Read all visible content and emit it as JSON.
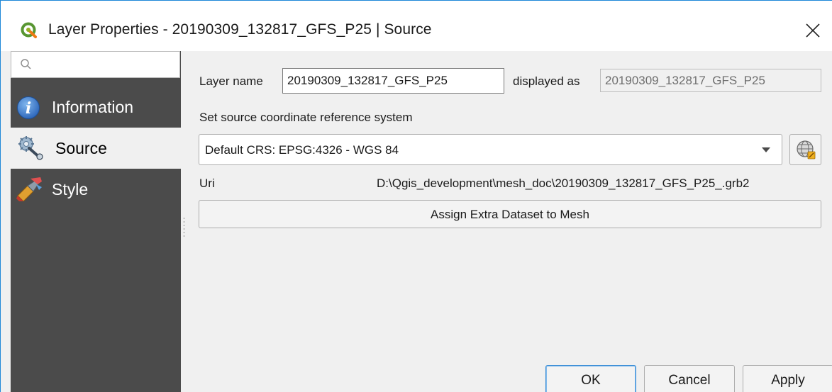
{
  "window": {
    "title": "Layer Properties - 20190309_132817_GFS_P25 | Source",
    "accent_color": "#1e88d8"
  },
  "sidebar": {
    "search": {
      "placeholder": "",
      "value": ""
    },
    "items": [
      {
        "label": "Information",
        "icon": "information-icon",
        "selected": false
      },
      {
        "label": "Source",
        "icon": "source-icon",
        "selected": true
      },
      {
        "label": "Style",
        "icon": "style-icon",
        "selected": false
      }
    ],
    "background_color": "#4b4b4b"
  },
  "source": {
    "layer_name_label": "Layer name",
    "layer_name_value": "20190309_132817_GFS_P25",
    "displayed_as_label": "displayed as",
    "displayed_as_value": "20190309_132817_GFS_P25",
    "crs_heading": "Set source coordinate reference system",
    "crs_selected": "Default CRS: EPSG:4326 - WGS 84",
    "crs_button_icon": "crs-globe-icon",
    "uri_label": "Uri",
    "uri_value": "D:\\Qgis_development\\mesh_doc\\20190309_132817_GFS_P25_.grb2",
    "assign_button": "Assign Extra Dataset to Mesh"
  },
  "buttons": {
    "ok": "OK",
    "cancel": "Cancel",
    "apply": "Apply"
  }
}
